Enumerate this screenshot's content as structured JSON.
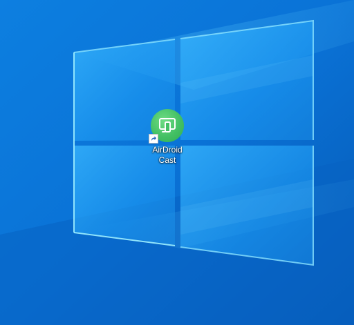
{
  "desktop": {
    "shortcut": {
      "label": "AirDroid\nCast",
      "icon": "airdroid-cast-icon",
      "overlay_icon": "shortcut-arrow-icon",
      "icon_color": "#43c064"
    },
    "wallpaper": {
      "name": "windows-10-hero-wallpaper",
      "base_color": "#0a6fd0",
      "light_color": "#2bb3ff"
    }
  }
}
